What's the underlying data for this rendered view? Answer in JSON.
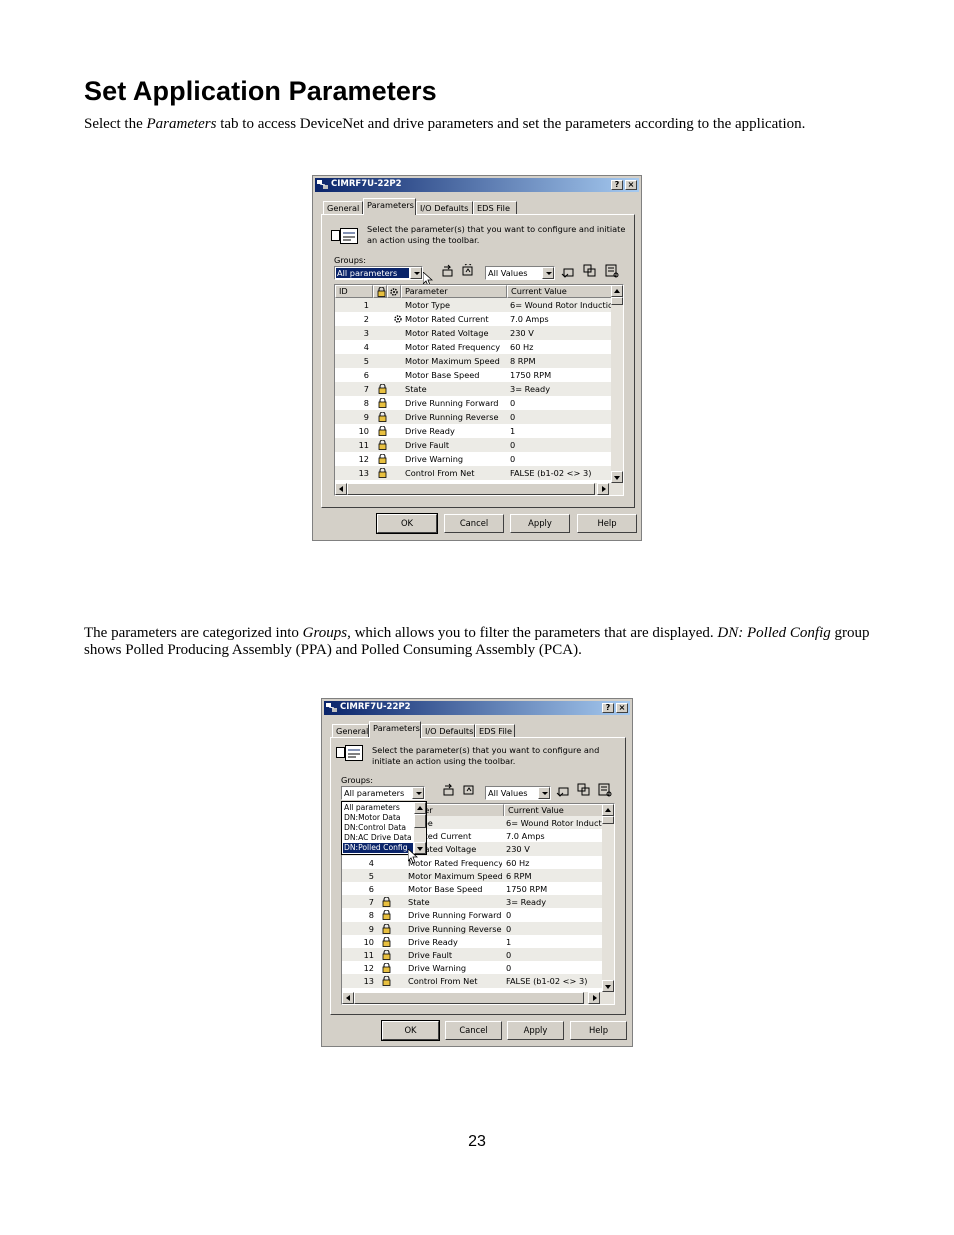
{
  "page": {
    "title": "Set Application Parameters",
    "intro": {
      "before": "Select the ",
      "em": "Parameters",
      "after": " tab to access DeviceNet and drive parameters and set the parameters according to the application."
    },
    "groups_para": {
      "p1": "The parameters are categorized into ",
      "em1": "Groups",
      "p2": ", which allows you to filter the parameters that are displayed. ",
      "em2": "DN: Polled Config",
      "p3": " group shows Polled Producing Assembly (PPA) and Polled Consuming Assembly (PCA)."
    },
    "page_number": "23"
  },
  "dialog": {
    "title": "CIMRF7U-22P2",
    "help_btn": "?",
    "close_btn": "×",
    "tabs": [
      "General",
      "Parameters",
      "I/O Defaults",
      "EDS File"
    ],
    "instruction": "Select the parameter(s) that you want to configure and initiate an action using the toolbar.",
    "groups_label": "Groups:",
    "groups_value": "All parameters",
    "values_value": "All Values",
    "columns": [
      "ID",
      "",
      "Parameter",
      "Current Value"
    ],
    "rows": [
      {
        "id": "1",
        "param": "Motor Type",
        "value": "6= Wound Rotor Induction",
        "icon": "none"
      },
      {
        "id": "2",
        "param": "Motor Rated Current",
        "value": "7.0 Amps",
        "icon": "gear"
      },
      {
        "id": "3",
        "param": "Motor Rated Voltage",
        "value": "230 V",
        "icon": "none"
      },
      {
        "id": "4",
        "param": "Motor Rated Frequency",
        "value": "60 Hz",
        "icon": "none"
      },
      {
        "id": "5",
        "param": "Motor Maximum Speed",
        "value": "8 RPM",
        "icon": "none"
      },
      {
        "id": "6",
        "param": "Motor Base Speed",
        "value": "1750 RPM",
        "icon": "none"
      },
      {
        "id": "7",
        "param": "State",
        "value": "3= Ready",
        "icon": "lock"
      },
      {
        "id": "8",
        "param": "Drive Running Forward",
        "value": "0",
        "icon": "lock"
      },
      {
        "id": "9",
        "param": "Drive Running Reverse",
        "value": "0",
        "icon": "lock"
      },
      {
        "id": "10",
        "param": "Drive Ready",
        "value": "1",
        "icon": "lock"
      },
      {
        "id": "11",
        "param": "Drive Fault",
        "value": "0",
        "icon": "lock"
      },
      {
        "id": "12",
        "param": "Drive Warning",
        "value": "0",
        "icon": "lock"
      },
      {
        "id": "13",
        "param": "Control From Net",
        "value": "FALSE (b1-02 <> 3)",
        "icon": "lock"
      }
    ],
    "buttons": {
      "ok": "OK",
      "cancel": "Cancel",
      "apply": "Apply",
      "help": "Help"
    }
  },
  "dialog2": {
    "dropdown_options": [
      "All parameters",
      "DN:Motor Data",
      "DN:Control Data",
      "DN:AC Drive Data",
      "DN:Polled Config"
    ],
    "highlighted_option": "DN:Polled Config",
    "row1_param_partial": "r Type",
    "row2_param_partial": "r Rated Current",
    "row3_param_partial": "or Rated Voltage",
    "col_param_partial": "meter",
    "row2_value": "7.0 Amps",
    "row5_value": "6 RPM"
  },
  "colors": {
    "dialog_face": "#d4d0c8",
    "titlebar_start": "#0a246a",
    "titlebar_end": "#a6caf0",
    "selection": "#0a246a",
    "row_alt": "#ecebe6"
  }
}
